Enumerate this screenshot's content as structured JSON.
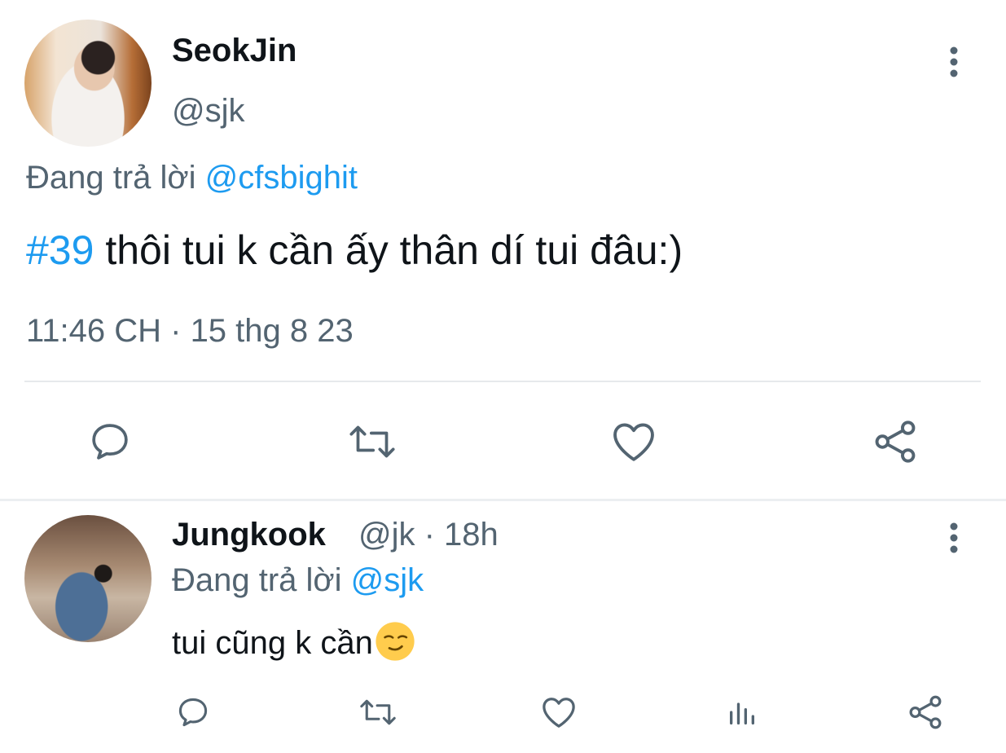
{
  "main_tweet": {
    "name": "SeokJin",
    "handle": "@sjk",
    "reply_prefix": "Đang trả lời ",
    "reply_target": "@cfsbighit",
    "hashtag": "#39",
    "text": " thôi tui k cần ấy thân dí tui đâu:)",
    "timestamp": "11:46 CH · 15 thg 8 23",
    "actions": [
      "reply-icon",
      "retweet-icon",
      "like-icon",
      "share-icon"
    ]
  },
  "reply_tweet": {
    "name": "Jungkook",
    "meta": "@jk · 18h",
    "reply_prefix": "Đang trả lời ",
    "reply_target": "@sjk",
    "text": "tui cũng k cần",
    "emoji": "smirking-face-emoji",
    "actions": [
      "reply-icon",
      "retweet-icon",
      "like-icon",
      "analytics-icon",
      "share-icon"
    ]
  },
  "colors": {
    "link": "#1d9bf0",
    "secondary_text": "#536471",
    "icon": "#536471",
    "divider": "#e6e9ec"
  }
}
